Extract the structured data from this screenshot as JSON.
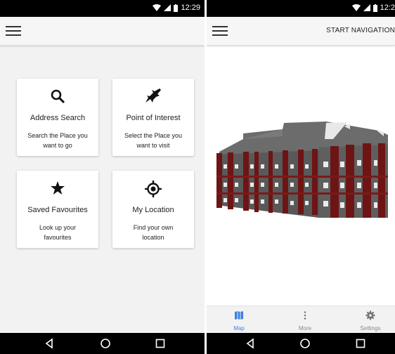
{
  "status": {
    "time_left": "12:29",
    "time_right": "12:2"
  },
  "left_screen": {
    "cards": [
      {
        "icon": "search-icon",
        "title": "Address Search",
        "desc_line1": "Search the Place you",
        "desc_line2": "want to go"
      },
      {
        "icon": "airplane-icon",
        "title": "Point of Interest",
        "desc_line1": "Select the Place you",
        "desc_line2": "want to visit"
      },
      {
        "icon": "star-icon",
        "title": "Saved Favourites",
        "desc_line1": "Look up your",
        "desc_line2": "favourites"
      },
      {
        "icon": "location-target-icon",
        "title": "My Location",
        "desc_line1": "Find your own",
        "desc_line2": "location"
      }
    ]
  },
  "right_screen": {
    "action_label": "START NAVIGATION",
    "bottom_nav": [
      {
        "icon": "map-icon",
        "label": "Map",
        "active": true
      },
      {
        "icon": "more-vert-icon",
        "label": "More",
        "active": false
      },
      {
        "icon": "gear-icon",
        "label": "Settings",
        "active": false
      }
    ]
  },
  "colors": {
    "accent": "#3f7fe0",
    "status_bar": "#000000",
    "building_red": "#6e1414",
    "building_gray": "#595959"
  }
}
